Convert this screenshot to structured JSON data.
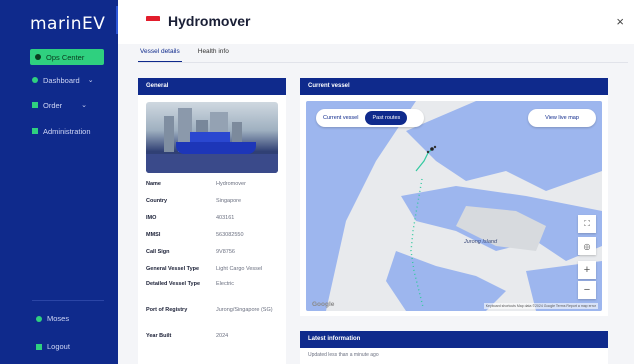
{
  "sidebar": {
    "logo": "marinEV",
    "collapse": "«",
    "items": [
      {
        "label": "Ops Center",
        "icon": "ops-icon"
      },
      {
        "label": "Dashboard",
        "icon": "dashboard-icon"
      },
      {
        "label": "Order",
        "icon": "order-icon"
      },
      {
        "label": "Administration",
        "icon": "admin-icon"
      }
    ],
    "user": "Moses",
    "logout": "Logout"
  },
  "header": {
    "title": "Hydromover",
    "close": "×"
  },
  "tabs": [
    "Vessel details",
    "Health info"
  ],
  "general": {
    "title": "General",
    "fields": [
      {
        "label": "Name",
        "value": "Hydromover"
      },
      {
        "label": "Country",
        "value": "Singapore"
      },
      {
        "label": "IMO",
        "value": "403161"
      },
      {
        "label": "MMSI",
        "value": "563082550"
      },
      {
        "label": "Call Sign",
        "value": "9V8756"
      },
      {
        "label": "General Vessel Type",
        "value": "Light Cargo Vessel"
      },
      {
        "label": "Detailed Vessel Type",
        "value": "Electric"
      },
      {
        "label": "Port of Registry",
        "value": "Jurong/Singapore (SG)"
      },
      {
        "label": "Year Built",
        "value": "2024"
      }
    ]
  },
  "current": {
    "title": "Current vessel",
    "toggle": [
      "Current vessel",
      "Past routes"
    ],
    "live_btn": "View live map",
    "map_label": "Jurong Island",
    "google": "Google",
    "footer": "Keyboard shortcuts   Map data ©2024 Google   Terms   Report a map error",
    "ctrl_full": "⛶",
    "ctrl_street": "◎",
    "ctrl_zoom_in": "+",
    "ctrl_zoom_out": "−"
  },
  "latest": {
    "title": "Latest information",
    "sub": "Updated less than a minute ago"
  }
}
